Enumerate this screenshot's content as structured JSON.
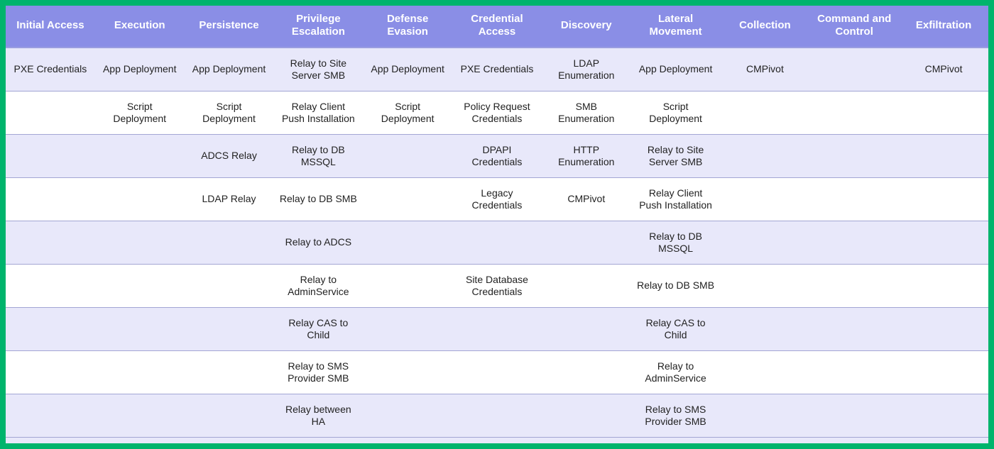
{
  "chart_data": {
    "type": "table",
    "title": "",
    "columns": [
      "Initial Access",
      "Execution",
      "Persistence",
      "Privilege Escalation",
      "Defense Evasion",
      "Credential Access",
      "Discovery",
      "Lateral Movement",
      "Collection",
      "Command and Control",
      "Exfiltration"
    ],
    "rows": [
      [
        "PXE Credentials",
        "App Deployment",
        "App Deployment",
        "Relay to Site Server SMB",
        "App Deployment",
        "PXE Credentials",
        "LDAP Enumeration",
        "App Deployment",
        "CMPivot",
        "",
        "CMPivot"
      ],
      [
        "",
        "Script Deployment",
        "Script Deployment",
        "Relay Client Push Installation",
        "Script Deployment",
        "Policy Request Credentials",
        "SMB Enumeration",
        "Script Deployment",
        "",
        "",
        ""
      ],
      [
        "",
        "",
        "ADCS Relay",
        "Relay to DB MSSQL",
        "",
        "DPAPI Credentials",
        "HTTP Enumeration",
        "Relay to Site Server SMB",
        "",
        "",
        ""
      ],
      [
        "",
        "",
        "LDAP Relay",
        "Relay to DB SMB",
        "",
        "Legacy Credentials",
        "CMPivot",
        "Relay Client Push Installation",
        "",
        "",
        ""
      ],
      [
        "",
        "",
        "",
        "Relay to ADCS",
        "",
        "",
        "",
        "Relay to DB MSSQL",
        "",
        "",
        ""
      ],
      [
        "",
        "",
        "",
        "Relay to AdminService",
        "",
        "Site Database Credentials",
        "",
        "Relay to DB SMB",
        "",
        "",
        ""
      ],
      [
        "",
        "",
        "",
        "Relay CAS to Child",
        "",
        "",
        "",
        "Relay CAS to Child",
        "",
        "",
        ""
      ],
      [
        "",
        "",
        "",
        "Relay to SMS Provider SMB",
        "",
        "",
        "",
        "Relay to AdminService",
        "",
        "",
        ""
      ],
      [
        "",
        "",
        "",
        "Relay between HA",
        "",
        "",
        "",
        "Relay to SMS Provider SMB",
        "",
        "",
        ""
      ]
    ]
  }
}
